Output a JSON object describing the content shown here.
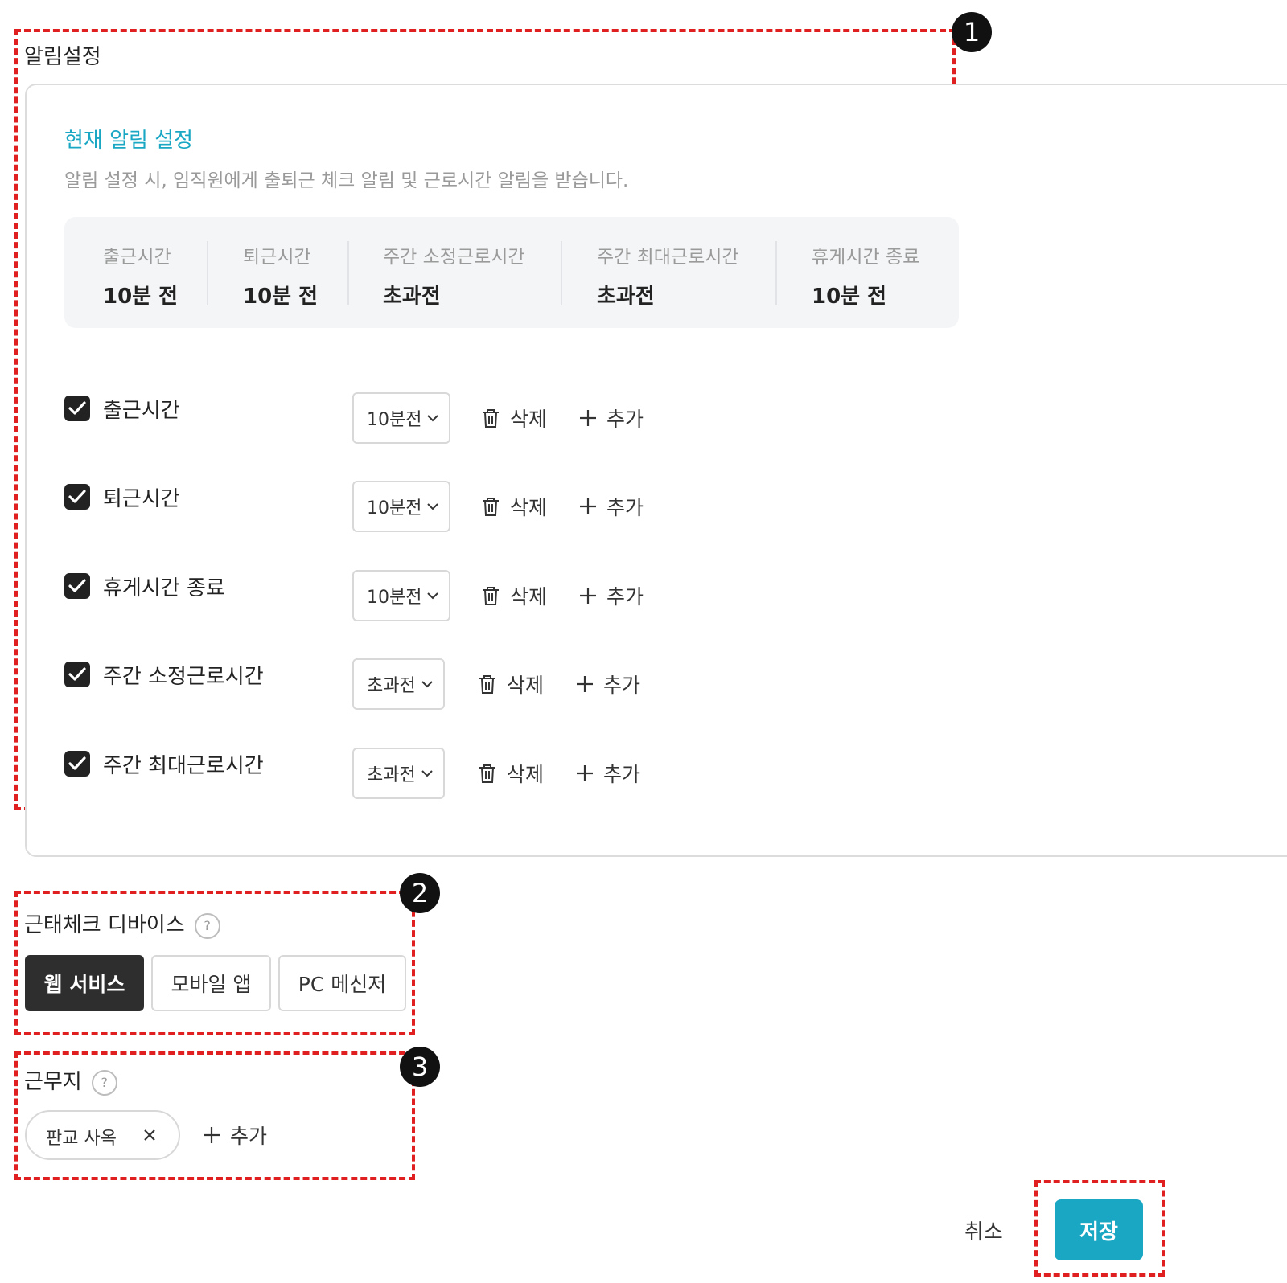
{
  "alarm": {
    "section_title": "알림설정",
    "current_title": "현재 알림 설정",
    "current_desc": "알림 설정 시, 임직원에게 출퇴근 체크 알림 및 근로시간 알림을 받습니다.",
    "summary": [
      {
        "label": "출근시간",
        "value": "10분 전"
      },
      {
        "label": "퇴근시간",
        "value": "10분 전"
      },
      {
        "label": "주간 소정근로시간",
        "value": "초과전"
      },
      {
        "label": "주간 최대근로시간",
        "value": "초과전"
      },
      {
        "label": "휴게시간 종료",
        "value": "10분 전"
      }
    ],
    "rows": [
      {
        "label": "출근시간",
        "checked": true,
        "select": "10분전"
      },
      {
        "label": "퇴근시간",
        "checked": true,
        "select": "10분전"
      },
      {
        "label": "휴게시간 종료",
        "checked": true,
        "select": "10분전"
      },
      {
        "label": "주간 소정근로시간",
        "checked": true,
        "select": "초과전"
      },
      {
        "label": "주간 최대근로시간",
        "checked": true,
        "select": "초과전"
      }
    ],
    "delete_label": "삭제",
    "add_label": "추가"
  },
  "device": {
    "title": "근태체크 디바이스",
    "help": "?",
    "options": [
      "웹 서비스",
      "모바일 앱",
      "PC 메신저"
    ],
    "selected": "웹 서비스"
  },
  "workplace": {
    "title": "근무지",
    "help": "?",
    "chips": [
      "판교 사옥"
    ],
    "add_label": "추가"
  },
  "footer": {
    "cancel_label": "취소",
    "save_label": "저장"
  },
  "markers": [
    "1",
    "2",
    "3"
  ],
  "colors": {
    "accent": "#1aa7c4",
    "annotation": "#e02020",
    "active_segment": "#2e2e2e"
  },
  "icons": {
    "checkbox": "checkbox-checked-icon",
    "select": "chevron-down-icon",
    "delete": "trash-icon",
    "add": "plus-icon",
    "help": "help-circle-icon",
    "remove_chip": "close-icon"
  }
}
